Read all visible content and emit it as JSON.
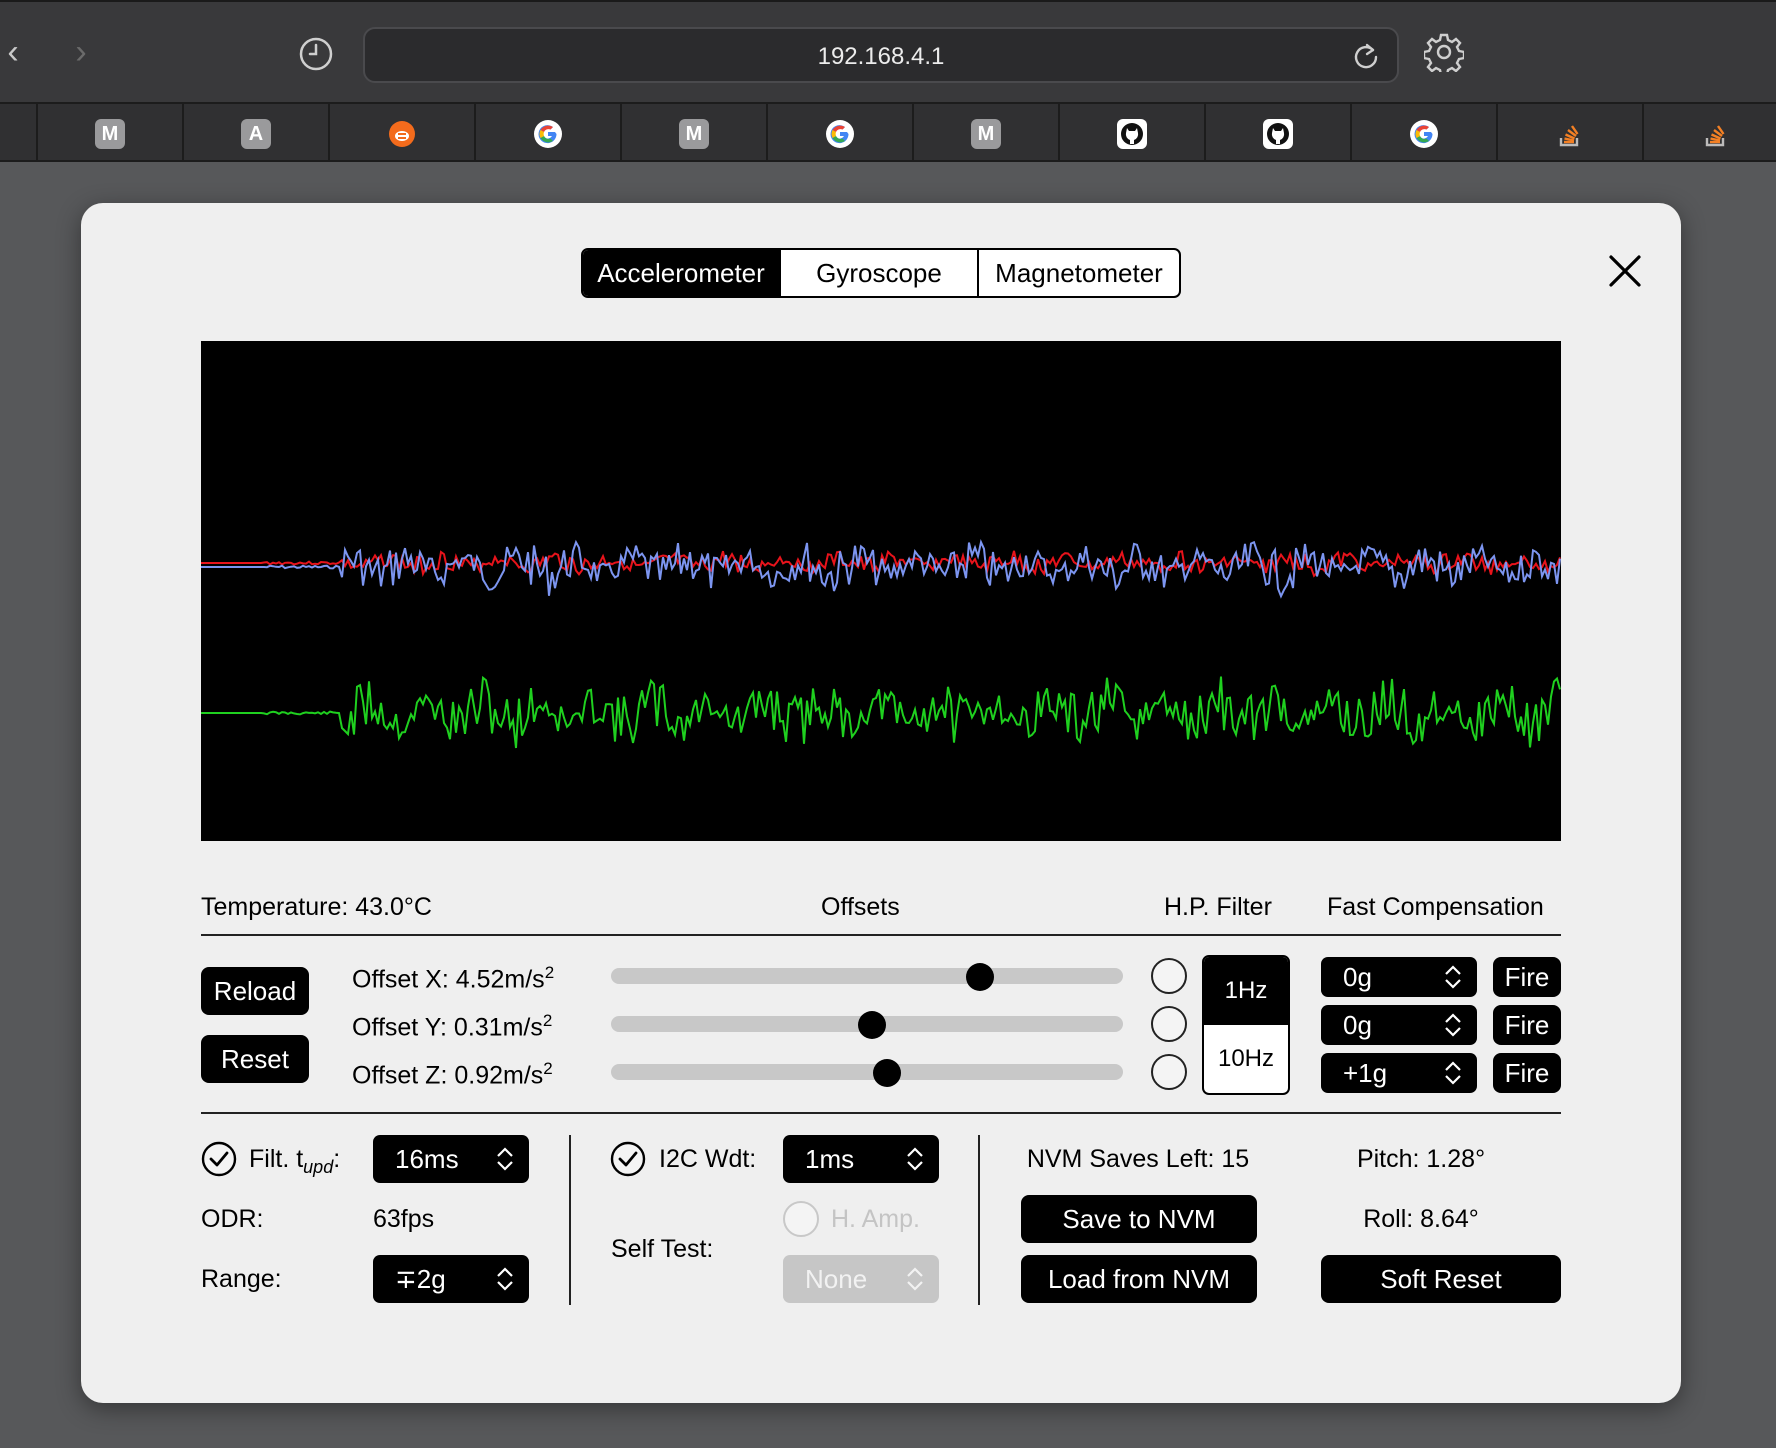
{
  "browser": {
    "url": "192.168.4.1",
    "icons": {
      "back": "chevron-left-icon",
      "forward": "chevron-right-icon",
      "history": "clock-icon",
      "reload": "reload-icon",
      "settings": "gear-icon"
    },
    "bookmarks": [
      {
        "icon": "m-icon",
        "letter": "M"
      },
      {
        "icon": "a-icon",
        "letter": "A"
      },
      {
        "icon": "bee-icon",
        "letter": ""
      },
      {
        "icon": "google-icon",
        "letter": "G"
      },
      {
        "icon": "m-icon",
        "letter": "M"
      },
      {
        "icon": "google-icon",
        "letter": "G"
      },
      {
        "icon": "m-icon",
        "letter": "M"
      },
      {
        "icon": "github-icon",
        "letter": ""
      },
      {
        "icon": "github-icon",
        "letter": ""
      },
      {
        "icon": "google-icon",
        "letter": "G"
      },
      {
        "icon": "stackoverflow-icon",
        "letter": ""
      },
      {
        "icon": "stackoverflow-icon",
        "letter": ""
      }
    ]
  },
  "tabs": [
    {
      "label": "Accelerometer",
      "active": true
    },
    {
      "label": "Gyroscope",
      "active": false
    },
    {
      "label": "Magnetometer",
      "active": false
    }
  ],
  "colors": {
    "series_red": "#e8131b",
    "series_blue": "#7c95f0",
    "series_green": "#1fd01f",
    "accent": "#000000"
  },
  "headers": {
    "temperature": "Temperature: 43.0°C",
    "offsets": "Offsets",
    "hp_filter": "H.P. Filter",
    "fast_comp": "Fast Compensation"
  },
  "buttons": {
    "reload": "Reload",
    "reset": "Reset",
    "save_nvm": "Save to NVM",
    "load_nvm": "Load from NVM",
    "soft_reset": "Soft Reset"
  },
  "offsets": [
    {
      "label": "Offset X: 4.52m/s",
      "sup": "2",
      "level": 0.72
    },
    {
      "label": "Offset Y: 0.31m/s",
      "sup": "2",
      "level": 0.51
    },
    {
      "label": "Offset Z: 0.92m/s",
      "sup": "2",
      "level": 0.54
    }
  ],
  "hp_filter": {
    "options": [
      "1Hz",
      "10Hz"
    ],
    "selected": "1Hz"
  },
  "fast_comp": [
    {
      "value": "0g",
      "fire": "Fire"
    },
    {
      "value": "0g",
      "fire": "Fire"
    },
    {
      "value": "+1g",
      "fire": "Fire"
    }
  ],
  "settings": {
    "filt_label": "Filt. t",
    "filt_sub": "upd",
    "filt_colon": ":",
    "filt_value": "16ms",
    "odr_label": "ODR:",
    "odr_value": "63fps",
    "range_label": "Range:",
    "range_value": "∓2g",
    "i2c_label": "I2C Wdt:",
    "i2c_value": "1ms",
    "h_amp_label": "H. Amp.",
    "self_test_label": "Self Test:",
    "self_test_value": "None",
    "nvm_saves": "NVM Saves Left: 15",
    "pitch": "Pitch: 1.28°",
    "roll": "Roll: 8.64°"
  }
}
